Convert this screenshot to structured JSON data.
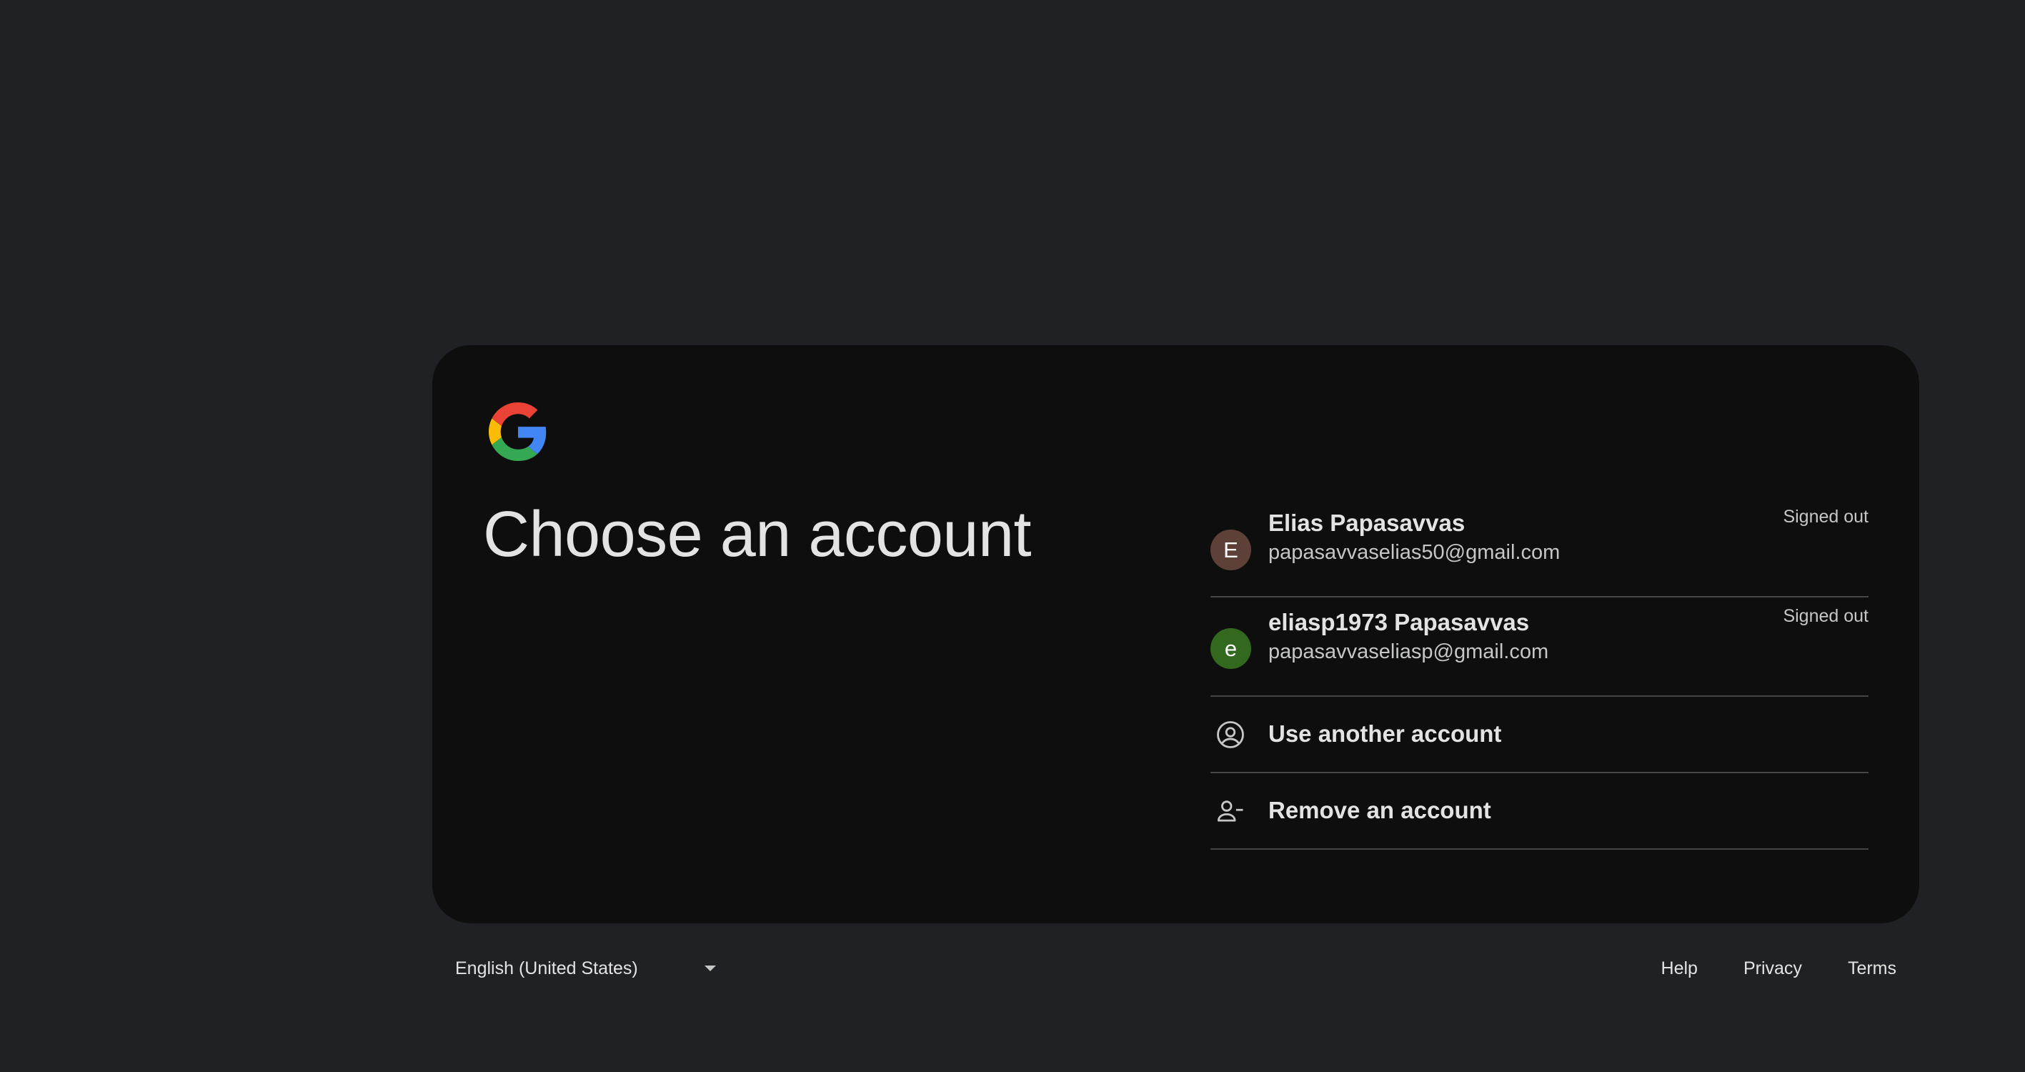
{
  "page": {
    "title": "Choose an account"
  },
  "accounts": [
    {
      "initial": "E",
      "name": "Elias Papasavvas",
      "email": "papasavvaselias50@gmail.com",
      "status": "Signed out",
      "avatar_color": "#5d4037"
    },
    {
      "initial": "e",
      "name": "eliasp1973 Papasavvas",
      "email": "papasavvaseliasp@gmail.com",
      "status": "Signed out",
      "avatar_color": "#33691e"
    }
  ],
  "actions": {
    "use_another": {
      "label": "Use another account",
      "icon": "account-circle-icon"
    },
    "remove": {
      "label": "Remove an account",
      "icon": "person-remove-icon"
    }
  },
  "footer": {
    "language": "English (United States)",
    "help": "Help",
    "privacy": "Privacy",
    "terms": "Terms"
  },
  "colors": {
    "page_background": "#202124",
    "card_background": "#0e0e0e",
    "divider": "#444746",
    "text_primary": "#e3e3e3",
    "text_secondary": "#c4c7c5"
  }
}
